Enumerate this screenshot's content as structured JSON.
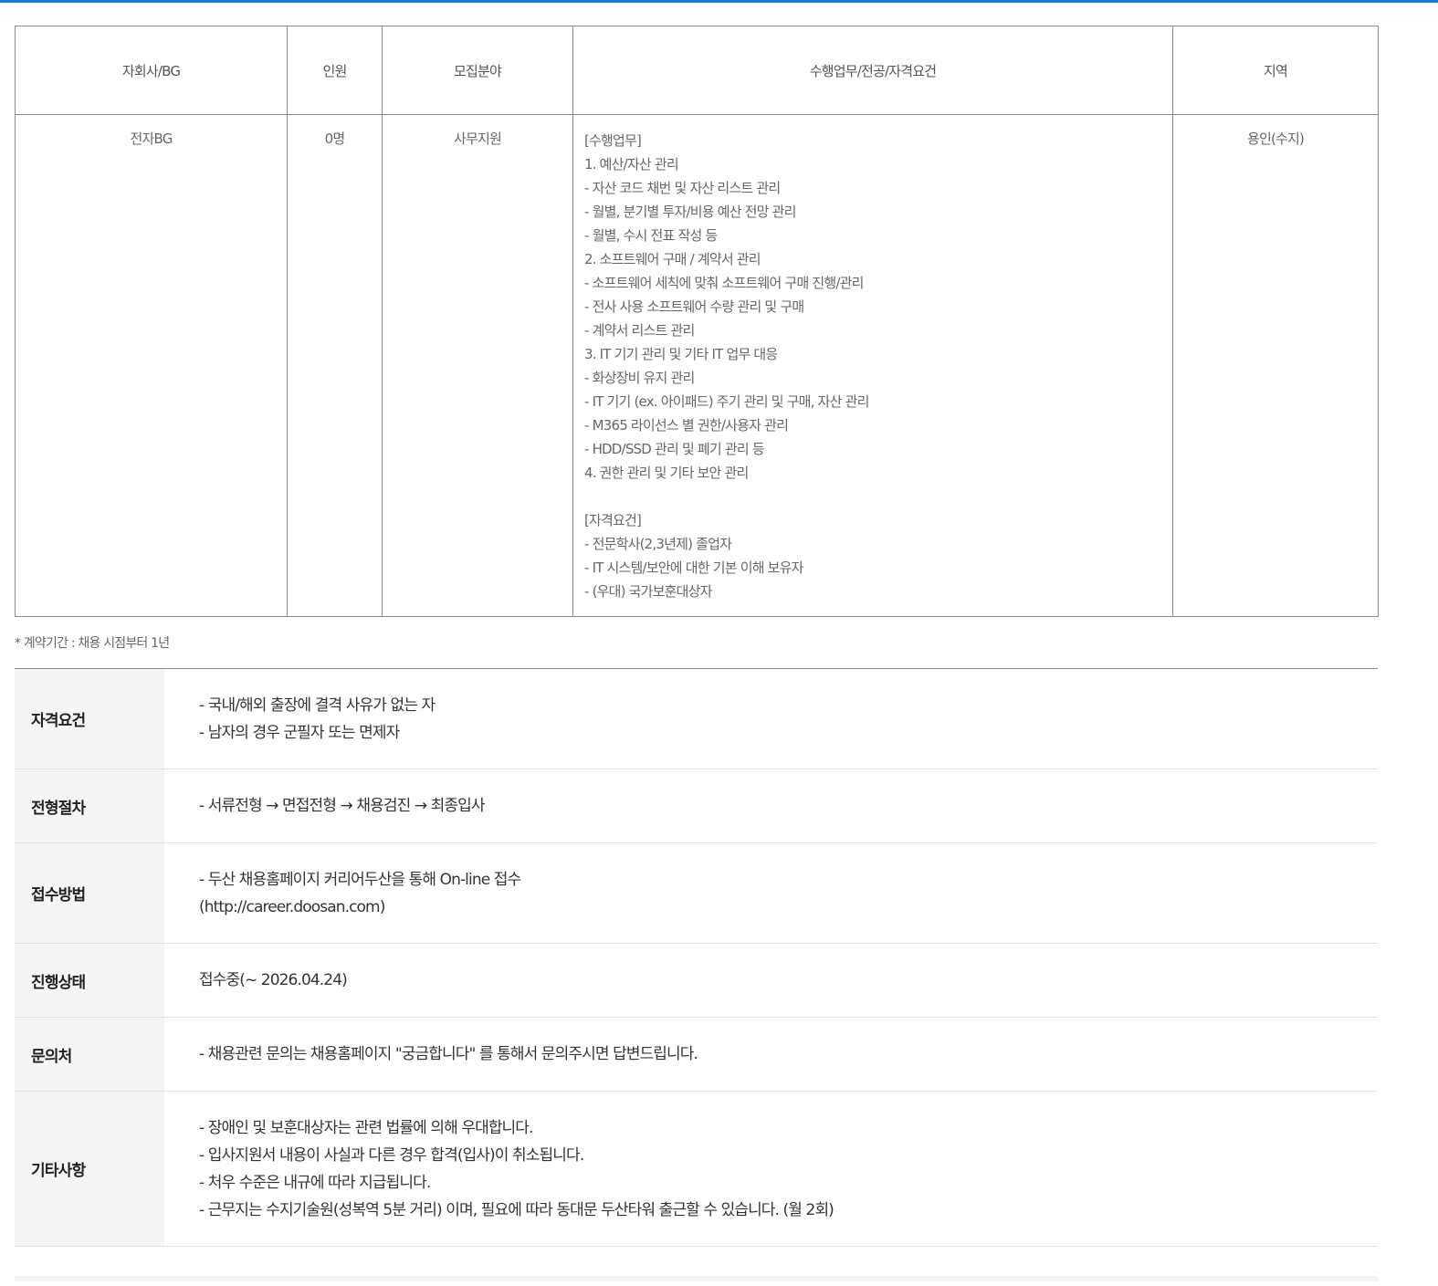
{
  "table": {
    "headers": [
      "자회사/BG",
      "인원",
      "모집분야",
      "수행업무/전공/자격요건",
      "지역"
    ],
    "row": {
      "company": "전자BG",
      "headcount": "0명",
      "field": "사무지원",
      "duties": [
        "[수행업무]",
        "1. 예산/자산 관리",
        "- 자산 코드 채번 및 자산 리스트 관리",
        "- 월별, 분기별 투자/비용 예산 전망 관리",
        "- 월별, 수시 전표 작성 등",
        "2. 소프트웨어 구매 / 계약서 관리",
        "- 소프트웨어 세칙에 맞춰 소프트웨어 구매 진행/관리",
        "- 전사 사용 소프트웨어 수량 관리 및 구매",
        "- 계약서 리스트 관리",
        "3. IT 기기 관리 및 기타 IT 업무 대응",
        "- 화상장비 유지 관리",
        "- IT 기기 (ex. 아이패드) 주기 관리 및 구매, 자산 관리",
        "- M365 라이선스 별 권한/사용자 관리",
        "- HDD/SSD 관리 및 폐기 관리 등",
        "4. 권한 관리 및 기타 보안 관리",
        "",
        "[자격요건]",
        "- 전문학사(2,3년제) 졸업자",
        "- IT 시스템/보안에 대한 기본 이해 보유자",
        "- (우대) 국가보훈대상자"
      ],
      "region": "용인(수지)"
    }
  },
  "note": "* 계약기간 : 채용 시점부터 1년",
  "info": {
    "qualifications": {
      "label": "자격요건",
      "lines": [
        "- 국내/해외 출장에 결격 사유가 없는 자",
        "- 남자의 경우 군필자 또는 면제자"
      ]
    },
    "process": {
      "label": "전형절차",
      "lines": [
        "- 서류전형 → 면접전형 → 채용검진 → 최종입사"
      ]
    },
    "apply": {
      "label": "접수방법",
      "lines": [
        "- 두산 채용홈페이지 커리어두산을 통해 On-line 접수",
        "(http://career.doosan.com)"
      ]
    },
    "status": {
      "label": "진행상태",
      "lines": [
        "접수중(~ 2026.04.24)"
      ]
    },
    "contact": {
      "label": "문의처",
      "lines": [
        "- 채용관련 문의는 채용홈페이지 \"궁금합니다\" 를 통해서 문의주시면 답변드립니다."
      ]
    },
    "etc": {
      "label": "기타사항",
      "lines": [
        "- 장애인 및 보훈대상자는 관련 법률에 의해 우대합니다.",
        "- 입사지원서 내용이 사실과 다른 경우 합격(입사)이 취소됩니다.",
        "- 처우 수준은 내규에 따라 지급됩니다.",
        "- 근무지는 수지기술원(성복역 5분 거리) 이며, 필요에 따라 동대문 두산타워 출근할 수 있습니다. (월 2회)"
      ]
    }
  },
  "colors": {
    "accent": "#1a7bd6",
    "label_bg": "#f5f5f5"
  }
}
